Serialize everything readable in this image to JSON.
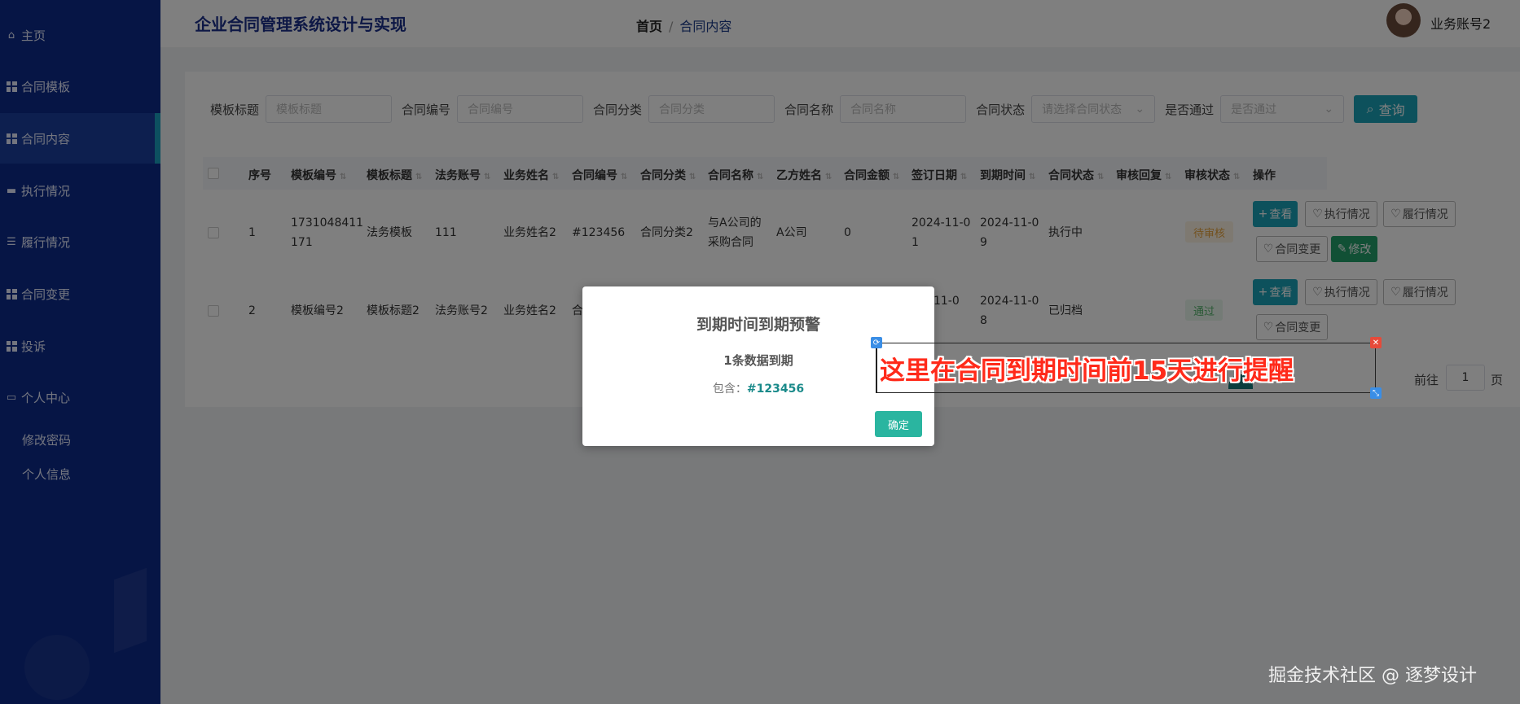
{
  "header": {
    "app_title": "企业合同管理系统设计与实现",
    "breadcrumb_home": "首页",
    "breadcrumb_separator": "/",
    "breadcrumb_current": "合同内容",
    "username": "业务账号2"
  },
  "sidebar": {
    "items": [
      {
        "label": "主页",
        "icon": "home-icon"
      },
      {
        "label": "合同模板",
        "icon": "grid-icon"
      },
      {
        "label": "合同内容",
        "icon": "grid-icon",
        "active": true
      },
      {
        "label": "执行情况",
        "icon": "briefcase-icon"
      },
      {
        "label": "履行情况",
        "icon": "list-icon"
      },
      {
        "label": "合同变更",
        "icon": "grid-icon"
      },
      {
        "label": "投诉",
        "icon": "grid-icon"
      },
      {
        "label": "个人中心",
        "icon": "card-icon"
      }
    ],
    "sub_items": [
      "修改密码",
      "个人信息"
    ]
  },
  "search": {
    "template_title_label": "模板标题",
    "template_title_placeholder": "模板标题",
    "contract_no_label": "合同编号",
    "contract_no_placeholder": "合同编号",
    "category_label": "合同分类",
    "category_placeholder": "合同分类",
    "name_label": "合同名称",
    "name_placeholder": "合同名称",
    "status_label": "合同状态",
    "status_placeholder": "请选择合同状态",
    "passed_label": "是否通过",
    "passed_placeholder": "是否通过",
    "query_label": "查询"
  },
  "table": {
    "headers": [
      "序号",
      "模板编号",
      "模板标题",
      "法务账号",
      "业务姓名",
      "合同编号",
      "合同分类",
      "合同名称",
      "乙方姓名",
      "合同金额",
      "签订日期",
      "到期时间",
      "合同状态",
      "审核回复",
      "审核状态",
      "操作"
    ],
    "rows": [
      {
        "index": "1",
        "template_no_l1": "1731048411",
        "template_no_l2": "171",
        "template_title": "法务模板",
        "legal_account": "111",
        "business_name": "业务姓名2",
        "contract_no": "#123456",
        "category": "合同分类2",
        "name_l1": "与A公司的",
        "name_l2": "采购合同",
        "party_b": "A公司",
        "amount": "0",
        "sign_l1": "2024-11-0",
        "sign_l2": "1",
        "due_l1": "2024-11-0",
        "due_l2": "9",
        "status": "执行中",
        "review_status": "待审核"
      },
      {
        "index": "2",
        "template_no": "模板编号2",
        "template_title": "模板标题2",
        "legal_account": "法务账号2",
        "business_name": "业务姓名2",
        "contract_no_partial": "合",
        "sign_l1": "4-11-0",
        "due_l1": "2024-11-0",
        "due_l2": "8",
        "status": "已归档",
        "review_status": "通过"
      }
    ],
    "actions": {
      "view": "查看",
      "execution": "执行情况",
      "performance": "履行情况",
      "change": "合同变更",
      "edit": "修改"
    }
  },
  "pager": {
    "goto_label": "前往",
    "page": "1",
    "page_suffix": "页"
  },
  "dialog": {
    "title": "到期时间到期预警",
    "subtitle": "1条数据到期",
    "content_prefix": "包含：",
    "content_code": "#123456",
    "confirm_label": "确定"
  },
  "annotation": {
    "text": "这里在合同到期时间前15天进行提醒"
  },
  "watermark": "掘金技术社区 @ 逐梦设计",
  "colors": {
    "sidebar": "#0d2a8a",
    "accent": "#1aa3b8",
    "annotation": "#ff2a1a",
    "confirm": "#2ab5a0"
  }
}
